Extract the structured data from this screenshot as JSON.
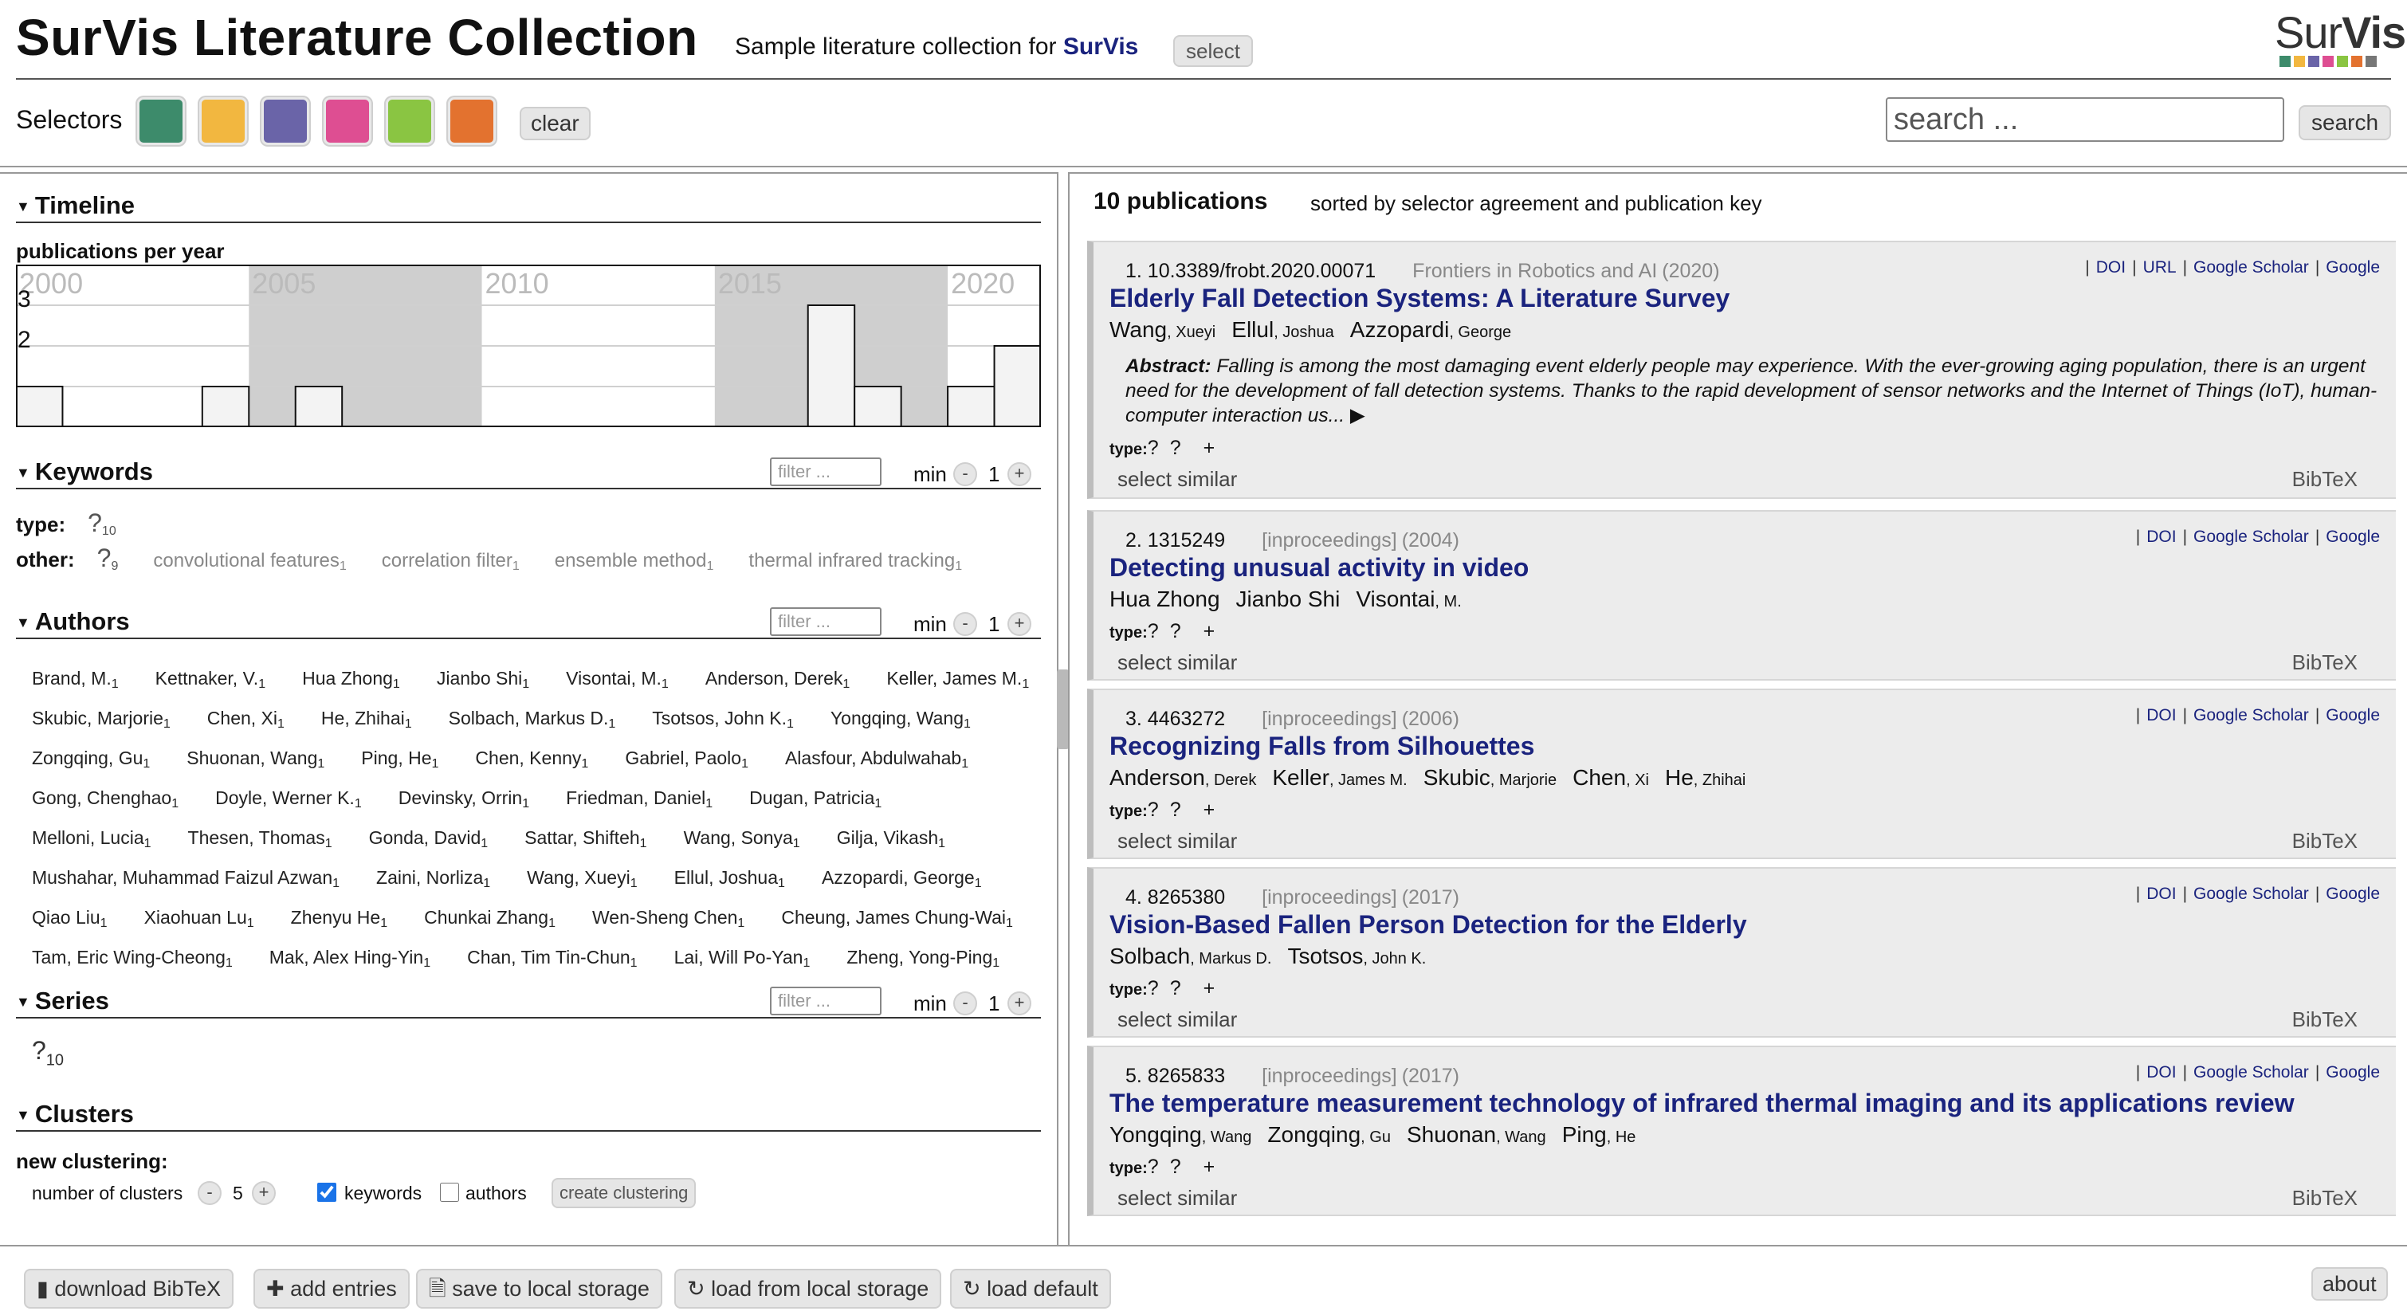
{
  "header": {
    "title": "SurVis Literature Collection",
    "subtitle_prefix": "Sample literature collection for ",
    "subtitle_brand": "SurVis",
    "select_label": "select",
    "logo_text_light": "Sur",
    "logo_text_bold": "Vis",
    "logo_colors": [
      "#3d8b6b",
      "#f2b740",
      "#6a64a8",
      "#de4e92",
      "#8ac542",
      "#e3722f",
      "#777777"
    ]
  },
  "selectors": {
    "label": "Selectors",
    "swatches": [
      "#3d8b6b",
      "#f2b740",
      "#6a64a8",
      "#de4e92",
      "#8ac542",
      "#e3722f"
    ],
    "clear_label": "clear",
    "search_placeholder": "search ...",
    "search_label": "search"
  },
  "timeline": {
    "title": "Timeline",
    "chart_label": "publications per year",
    "chart_data": {
      "type": "bar",
      "title": "publications per year",
      "x_tick_labels": [
        "2000",
        "2005",
        "2010",
        "2015",
        "2020"
      ],
      "y_tick_labels": [
        "3",
        "2"
      ],
      "x": [
        2000,
        2004,
        2006,
        2017,
        2018,
        2020,
        2021
      ],
      "values": [
        1,
        1,
        1,
        3,
        1,
        1,
        2
      ],
      "xlim": [
        2000,
        2021
      ],
      "ylim": [
        0,
        4
      ],
      "shaded_periods": [
        [
          2005,
          2009
        ],
        [
          2015,
          2019
        ]
      ]
    }
  },
  "keywords": {
    "title": "Keywords",
    "filter_placeholder": "filter ...",
    "min_label": "min",
    "min_value": "1",
    "minus": "-",
    "plus": "+",
    "type_label": "type:",
    "type_tags": [
      {
        "text": "?",
        "count": "10"
      }
    ],
    "other_label": "other:",
    "other_tags": [
      {
        "text": "?",
        "count": "9"
      },
      {
        "text": "convolutional features",
        "count": "1"
      },
      {
        "text": "correlation filter",
        "count": "1"
      },
      {
        "text": "ensemble method",
        "count": "1"
      },
      {
        "text": "thermal infrared tracking",
        "count": "1"
      }
    ]
  },
  "authors": {
    "title": "Authors",
    "filter_placeholder": "filter ...",
    "min_label": "min",
    "min_value": "1",
    "list": [
      "Brand, M.",
      "Kettnaker, V.",
      "Hua Zhong",
      "Jianbo Shi",
      "Visontai, M.",
      "Anderson, Derek",
      "Keller, James M.",
      "Skubic, Marjorie",
      "Chen, Xi",
      "He, Zhihai",
      "Solbach, Markus D.",
      "Tsotsos, John K.",
      "Yongqing, Wang",
      "Zongqing, Gu",
      "Shuonan, Wang",
      "Ping, He",
      "Chen, Kenny",
      "Gabriel, Paolo",
      "Alasfour, Abdulwahab",
      "Gong, Chenghao",
      "Doyle, Werner K.",
      "Devinsky, Orrin",
      "Friedman, Daniel",
      "Dugan, Patricia",
      "Melloni, Lucia",
      "Thesen, Thomas",
      "Gonda, David",
      "Sattar, Shifteh",
      "Wang, Sonya",
      "Gilja, Vikash",
      "Mushahar, Muhammad Faizul Azwan",
      "Zaini, Norliza",
      "Wang, Xueyi",
      "Ellul, Joshua",
      "Azzopardi, George",
      "Qiao Liu",
      "Xiaohuan Lu",
      "Zhenyu He",
      "Chunkai Zhang",
      "Wen-Sheng Chen",
      "Cheung, James Chung-Wai",
      "Tam, Eric Wing-Cheong",
      "Mak, Alex Hing-Yin",
      "Chan, Tim Tin-Chun",
      "Lai, Will Po-Yan",
      "Zheng, Yong-Ping"
    ],
    "count": "1"
  },
  "series": {
    "title": "Series",
    "filter_placeholder": "filter ...",
    "min_label": "min",
    "min_value": "1",
    "value": "?",
    "count": "10"
  },
  "clusters": {
    "title": "Clusters",
    "new_label": "new clustering:",
    "number_label": "number of clusters",
    "number_value": "5",
    "keywords_label": "keywords",
    "authors_label": "authors",
    "create_label": "create clustering"
  },
  "publications": {
    "count_label": "10 publications",
    "sort_label": "sorted by selector agreement and publication key",
    "select_similar": "select similar",
    "bibtex": "BibTeX",
    "type_label": "type:",
    "abstract_label": "Abstract:",
    "items": [
      {
        "num": "1.",
        "key": "10.3389/frobt.2020.00071",
        "venue": "Frontiers in Robotics and AI",
        "year": "(2020)",
        "links": [
          "DOI",
          "URL",
          "Google Scholar",
          "Google"
        ],
        "title": "Elderly Fall Detection Systems: A Literature Survey",
        "authors": [
          {
            "last": "Wang",
            "first": "Xueyi"
          },
          {
            "last": "Ellul",
            "first": "Joshua"
          },
          {
            "last": "Azzopardi",
            "first": "George"
          }
        ],
        "abstract": "Falling is among the most damaging event elderly people may experience. With the ever-growing aging population, there is an urgent need for the development of fall detection systems. Thanks to the rapid development of sensor networks and the Internet of Things (IoT), human-computer interaction us... ▶"
      },
      {
        "num": "2.",
        "key": "1315249",
        "venue": "[inproceedings]",
        "year": "(2004)",
        "links": [
          "DOI",
          "Google Scholar",
          "Google"
        ],
        "title": "Detecting unusual activity in video",
        "authors": [
          {
            "last": "Hua Zhong",
            "first": ""
          },
          {
            "last": "Jianbo Shi",
            "first": ""
          },
          {
            "last": "Visontai",
            "first": "M."
          }
        ]
      },
      {
        "num": "3.",
        "key": "4463272",
        "venue": "[inproceedings]",
        "year": "(2006)",
        "links": [
          "DOI",
          "Google Scholar",
          "Google"
        ],
        "title": "Recognizing Falls from Silhouettes",
        "authors": [
          {
            "last": "Anderson",
            "first": "Derek"
          },
          {
            "last": "Keller",
            "first": "James M."
          },
          {
            "last": "Skubic",
            "first": "Marjorie"
          },
          {
            "last": "Chen",
            "first": "Xi"
          },
          {
            "last": "He",
            "first": "Zhihai"
          }
        ]
      },
      {
        "num": "4.",
        "key": "8265380",
        "venue": "[inproceedings]",
        "year": "(2017)",
        "links": [
          "DOI",
          "Google Scholar",
          "Google"
        ],
        "title": "Vision-Based Fallen Person Detection for the Elderly",
        "authors": [
          {
            "last": "Solbach",
            "first": "Markus D."
          },
          {
            "last": "Tsotsos",
            "first": "John K."
          }
        ]
      },
      {
        "num": "5.",
        "key": "8265833",
        "venue": "[inproceedings]",
        "year": "(2017)",
        "links": [
          "DOI",
          "Google Scholar",
          "Google"
        ],
        "title": "The temperature measurement technology of infrared thermal imaging and its applications review",
        "authors": [
          {
            "last": "Yongqing",
            "first": "Wang"
          },
          {
            "last": "Zongqing",
            "first": "Gu"
          },
          {
            "last": "Shuonan",
            "first": "Wang"
          },
          {
            "last": "Ping",
            "first": "He"
          }
        ]
      }
    ]
  },
  "footer": {
    "download_label": "download BibTeX",
    "add_label": "add entries",
    "save_label": "save to local storage",
    "load_label": "load from local storage",
    "default_label": "load default",
    "about_label": "about"
  }
}
